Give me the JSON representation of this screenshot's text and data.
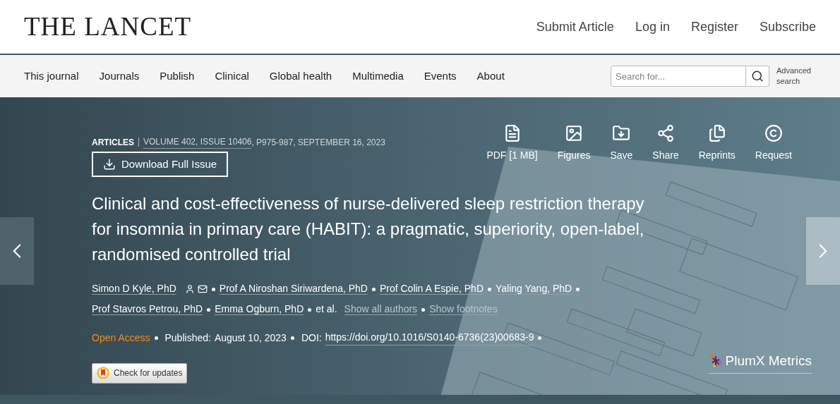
{
  "header": {
    "logo": "THE LANCET",
    "links": [
      "Submit Article",
      "Log in",
      "Register",
      "Subscribe"
    ]
  },
  "nav": {
    "items": [
      "This journal",
      "Journals",
      "Publish",
      "Clinical",
      "Global health",
      "Multimedia",
      "Events",
      "About"
    ],
    "search": {
      "placeholder": "Search for..."
    },
    "advanced_search": "Advanced search"
  },
  "article": {
    "section": "ARTICLES",
    "issue_link": "VOLUME 402, ISSUE 10406",
    "issue_rest": ", P975-987, SEPTEMBER 16, 2023",
    "download_button": "Download Full Issue",
    "tools": [
      {
        "kind": "pdf",
        "label": "PDF [1 MB]"
      },
      {
        "kind": "figures",
        "label": "Figures"
      },
      {
        "kind": "save",
        "label": "Save"
      },
      {
        "kind": "share",
        "label": "Share"
      },
      {
        "kind": "reprints",
        "label": "Reprints"
      },
      {
        "kind": "request",
        "label": "Request"
      }
    ],
    "title": "Clinical and cost-effectiveness of nurse-delivered sleep restriction therapy for insomnia in primary care (HABIT): a pragmatic, superiority, open-label, randomised controlled trial",
    "authors": [
      {
        "name": "Simon D Kyle, PhD",
        "corresponding": true
      },
      {
        "name": "Prof A Niroshan Siriwardena, PhD",
        "corresponding": false
      },
      {
        "name": "Prof Colin A Espie, PhD",
        "corresponding": false
      },
      {
        "name": "Yaling Yang, PhD",
        "corresponding": false
      },
      {
        "name": "Prof Stavros Petrou, PhD",
        "corresponding": false
      },
      {
        "name": "Emma Ogburn, PhD",
        "corresponding": false
      }
    ],
    "et_al": "et al.",
    "author_links": [
      "Show all authors",
      "Show footnotes"
    ],
    "open_access": "Open Access",
    "published_label": "Published:",
    "published_date": "August 10, 2023",
    "doi_label": "DOI:",
    "doi": "https://doi.org/10.1016/S0140-6736(23)00683-9",
    "check_updates": "Check for updates",
    "plumx": "PlumX Metrics"
  }
}
